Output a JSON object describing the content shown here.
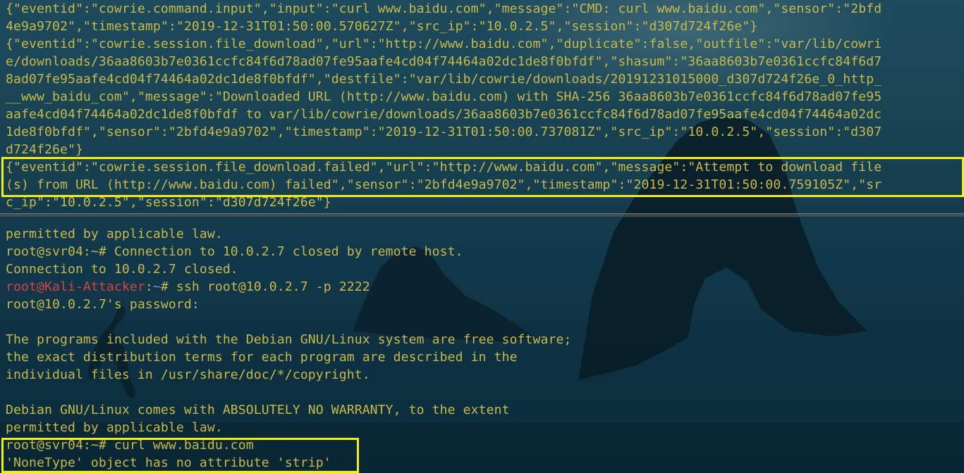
{
  "top_pane": {
    "lines": [
      "{\"eventid\":\"cowrie.command.input\",\"input\":\"curl www.baidu.com\",\"message\":\"CMD: curl www.baidu.com\",\"sensor\":\"2bfd",
      "4e9a9702\",\"timestamp\":\"2019-12-31T01:50:00.570627Z\",\"src_ip\":\"10.0.2.5\",\"session\":\"d307d724f26e\"}",
      "{\"eventid\":\"cowrie.session.file_download\",\"url\":\"http://www.baidu.com\",\"duplicate\":false,\"outfile\":\"var/lib/cowri",
      "e/downloads/36aa8603b7e0361ccfc84f6d78ad07fe95aafe4cd04f74464a02dc1de8f0bfdf\",\"shasum\":\"36aa8603b7e0361ccfc84f6d7",
      "8ad07fe95aafe4cd04f74464a02dc1de8f0bfdf\",\"destfile\":\"var/lib/cowrie/downloads/20191231015000_d307d724f26e_0_http_",
      "__www_baidu_com\",\"message\":\"Downloaded URL (http://www.baidu.com) with SHA-256 36aa8603b7e0361ccfc84f6d78ad07fe95",
      "aafe4cd04f74464a02dc1de8f0bfdf to var/lib/cowrie/downloads/36aa8603b7e0361ccfc84f6d78ad07fe95aafe4cd04f74464a02dc",
      "1de8f0bfdf\",\"sensor\":\"2bfd4e9a9702\",\"timestamp\":\"2019-12-31T01:50:00.737081Z\",\"src_ip\":\"10.0.2.5\",\"session\":\"d307",
      "d724f26e\"}",
      "{\"eventid\":\"cowrie.session.file_download.failed\",\"url\":\"http://www.baidu.com\",\"message\":\"Attempt to download file",
      "(s) from URL (http://www.baidu.com) failed\",\"sensor\":\"2bfd4e9a9702\",\"timestamp\":\"2019-12-31T01:50:00.759105Z\",\"sr",
      "c_ip\":\"10.0.2.5\",\"session\":\"d307d724f26e\"}"
    ]
  },
  "bottom_pane": {
    "line_0": "permitted by applicable law.",
    "line_1": "root@svr04:~# Connection to 10.0.2.7 closed by remote host.",
    "line_2": "Connection to 10.0.2.7 closed.",
    "prompt_user": "root@Kali-Attacker",
    "prompt_sep": ":",
    "prompt_path": "~",
    "prompt_cmd": "# ssh root@10.0.2.7 -p 2222",
    "line_4": "root@10.0.2.7's password:",
    "line_5": "",
    "line_6": "The programs included with the Debian GNU/Linux system are free software;",
    "line_7": "the exact distribution terms for each program are described in the",
    "line_8": "individual files in /usr/share/doc/*/copyright.",
    "line_9": "",
    "line_10": "Debian GNU/Linux comes with ABSOLUTELY NO WARRANTY, to the extent",
    "line_11": "permitted by applicable law.",
    "line_12": "root@svr04:~# curl www.baidu.com",
    "line_13": "'NoneType' object has no attribute 'strip'"
  },
  "colors": {
    "text": "#c8b94a",
    "prompt_user": "#d34545",
    "prompt_path": "#6f8fd8",
    "highlight": "#f2ef1a"
  }
}
